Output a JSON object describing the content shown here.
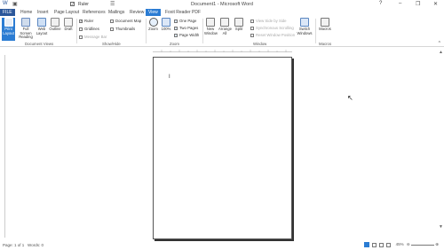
{
  "window": {
    "title": "Document1 - Microsoft Word",
    "ruler_label": "Ruler",
    "ruler_checked": "✓",
    "minimize": "–",
    "restore": "❐",
    "close": "✕",
    "help": "?"
  },
  "file_button": "FILE",
  "tabs": [
    "Home",
    "Insert",
    "Page Layout",
    "References",
    "Mailings",
    "Review",
    "View",
    "Foxit Reader PDF"
  ],
  "active_tab": "View",
  "ribbon": {
    "document_views": {
      "label": "Document Views",
      "buttons": [
        "Print Layout",
        "Full Screen Reading",
        "Web Layout",
        "Outline",
        "Draft"
      ]
    },
    "show_hide": {
      "label": "Show/Hide",
      "checks": [
        {
          "label": "Ruler",
          "checked": "✓"
        },
        {
          "label": "Gridlines",
          "checked": ""
        },
        {
          "label": "Message Bar",
          "checked": ""
        },
        {
          "label": "Document Map",
          "checked": ""
        },
        {
          "label": "Thumbnails",
          "checked": ""
        }
      ]
    },
    "zoom": {
      "label": "Zoom",
      "zoom": "Zoom",
      "hundred": "100%",
      "one_page": "One Page",
      "two_pages": "Two Pages",
      "page_width": "Page Width"
    },
    "window": {
      "label": "Window",
      "buttons": [
        "New Window",
        "Arrange All",
        "Split"
      ],
      "side_by_side": "View Side by Side",
      "sync_scroll": "Synchronous Scrolling",
      "reset_pos": "Reset Window Position",
      "switch": "Switch Windows"
    },
    "macros": {
      "label": "Macros",
      "button": "Macros"
    }
  },
  "document": {
    "cursor": "I",
    "mouse": "↖"
  },
  "status": {
    "page": "Page: 1 of 1",
    "words": "Words: 0",
    "zoom": "45%"
  },
  "colors": {
    "accent": "#2b7cd3",
    "brand": "#2b579a"
  }
}
